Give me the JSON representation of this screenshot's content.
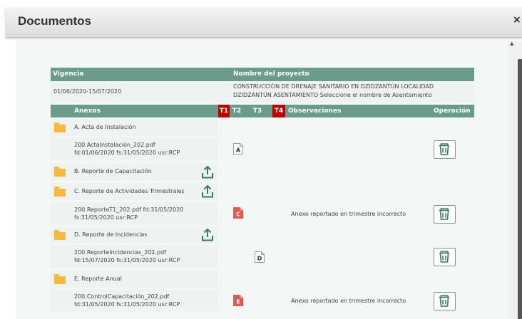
{
  "dialog": {
    "title": "Documentos",
    "close": "×"
  },
  "project": {
    "vigencia_header": "Vigencia",
    "nombre_header": "Nombre del proyecto",
    "vigencia": "01/06/2020-15/07/2020",
    "nombre_line1": "CONSTRUCCIÓN DE DRENAJE SANITARIO EN DZIDZANTÚN LOCALIDAD",
    "nombre_line2": "DZIDZANTÚN ASENTAMIENTO Seleccione el nombre de Asentamiento"
  },
  "table": {
    "headers": {
      "anexos": "Anexos",
      "t1": "T1",
      "t2": "T2",
      "t3": "T3",
      "t4": "T4",
      "observaciones": "Observaciones",
      "operacion": "Operación"
    }
  },
  "sections": [
    {
      "label": "A. Acta de Instalación",
      "upload": false,
      "file": {
        "line1": "200.ActaInstalación_202.pdf",
        "line2": "fd:01/06/2020 fs:31/05/2020 usr:RCP",
        "doc_letter": "A",
        "doc_style": "white",
        "obs": ""
      }
    },
    {
      "label": "B. Reporte de Capacitación",
      "upload": true,
      "file": null
    },
    {
      "label": "C. Reporte de Actividades Trimestrales",
      "upload": true,
      "file": {
        "line1": "200.ReporteT1_202.pdf fd:31/05/2020",
        "line2": "fs:31/05/2020 usr:RCP",
        "doc_letter": "C",
        "doc_style": "red",
        "obs": "Anexo reportado en trimestre incorrecto"
      }
    },
    {
      "label": "D. Reporte de Incidencias",
      "upload": true,
      "file": {
        "line1": "200.ReporteIncidencias_202.pdf",
        "line2": "fd:15/07/2020 fs:31/05/2020 usr:RCP",
        "doc_letter": "D",
        "doc_style": "white",
        "obs": ""
      }
    },
    {
      "label": "E. Reporte Anual",
      "upload": false,
      "file": {
        "line1": "200.ControlCapacitación_202.pdf",
        "line2": "fd:31/05/2020 fs:31/05/2020 usr:RCP",
        "doc_letter": "E",
        "doc_style": "red",
        "obs": "Anexo reportado en trimestre incorrecto"
      }
    }
  ],
  "colors": {
    "header_bg": "#6a9b8c",
    "t_red": "#c00000",
    "folder": "#f5b940",
    "upload_green": "#2e7d5b",
    "doc_red": "#e05a52"
  },
  "icons": {
    "folder": "folder-icon",
    "upload": "upload-icon",
    "trash": "trash-icon",
    "doc": "document-icon"
  }
}
